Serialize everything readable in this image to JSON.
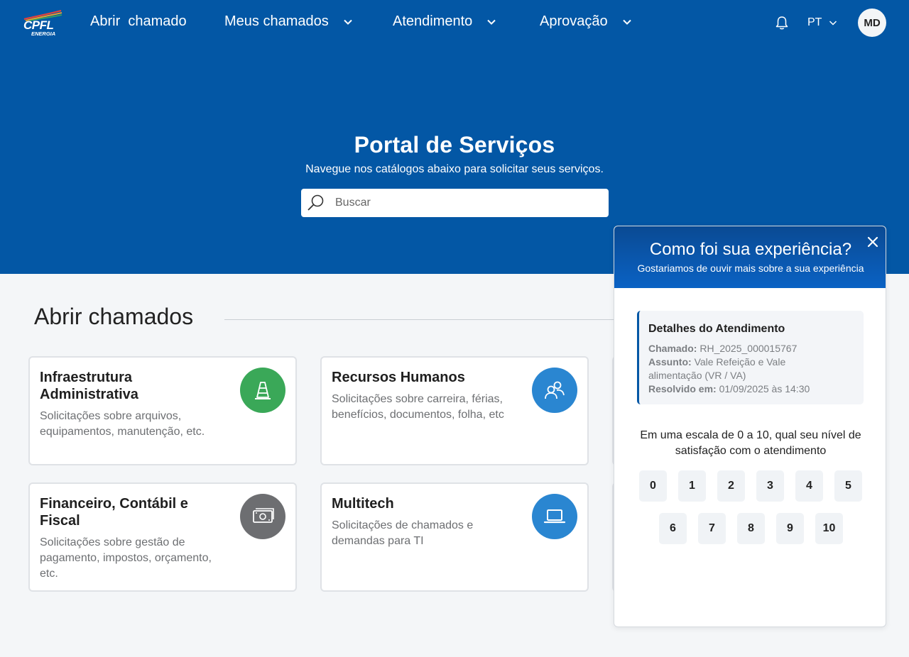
{
  "brand": {
    "logo_text": "CPFL",
    "logo_sub": "ENERGIA"
  },
  "nav": {
    "open_ticket": "Abrir  chamado",
    "my_tickets": "Meus chamados",
    "service": "Atendimento",
    "approval": "Aprovação",
    "language": "PT",
    "avatar_initials": "MD",
    "icons": [
      "bell-icon",
      "chevron-down-icon"
    ]
  },
  "hero": {
    "title": "Portal de Serviços",
    "subtitle": "Navegue nos catálogos abaixo para solicitar seus serviços.",
    "search_placeholder": "Buscar"
  },
  "section": {
    "title": "Abrir chamados"
  },
  "cards": [
    {
      "title": "Infraestrutura Administrativa",
      "description": "Solicitações sobre arquivos, equipamentos, manutenção, etc.",
      "icon": "road-cone-icon",
      "color": "#3aa858"
    },
    {
      "title": "Recursos Humanos",
      "description": "Solicitações sobre carreira, férias, benefícios, documentos, folha, etc",
      "icon": "people-icon",
      "color": "#2a86d1"
    },
    {
      "title": "Financeiro, Contábil e Fiscal",
      "description": "Solicitações sobre gestão de pagamento, impostos, orçamento, etc.",
      "icon": "money-icon",
      "color": "#6d6e71"
    },
    {
      "title": "Multitech",
      "description": "Solicitações de chamados e demandas para TI",
      "icon": "laptop-icon",
      "color": "#2a86d1"
    }
  ],
  "modal": {
    "title": "Como foi sua experiência?",
    "subtitle": "Gostariamos de ouvir mais sobre a sua experiência",
    "details_title": "Detalhes do Atendimento",
    "ticket_label": "Chamado:",
    "ticket_value": "RH_2025_000015767",
    "subject_label": "Assunto:",
    "subject_value": "Vale Refeição e Vale alimentação (VR / VA)",
    "resolved_label": "Resolvido em:",
    "resolved_value": "01/09/2025 às 14:30",
    "question": "Em uma escala de 0 a 10, qual seu nível de satisfação com o atendimento",
    "scores": [
      "0",
      "1",
      "2",
      "3",
      "4",
      "5",
      "6",
      "7",
      "8",
      "9",
      "10"
    ]
  },
  "colors": {
    "primary": "#0357a5",
    "background": "#f4f6f8"
  }
}
